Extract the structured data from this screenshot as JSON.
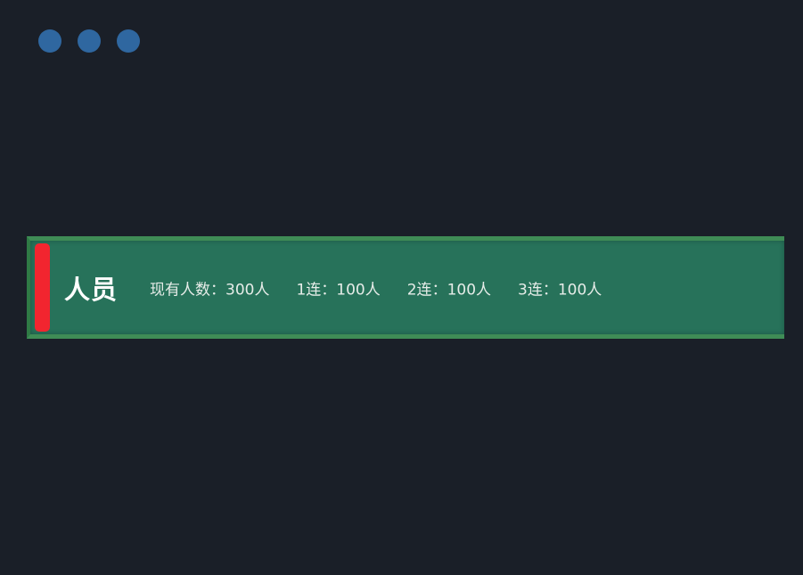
{
  "window_controls": {
    "dot_color": "#2f67a0",
    "dots": [
      "window-dot",
      "window-dot",
      "window-dot"
    ]
  },
  "banner": {
    "title": "人员",
    "accent_color": "#f2252f",
    "background_color": "#27725a",
    "stats": [
      {
        "label": "现有人数",
        "separator": "：",
        "value": "300人"
      },
      {
        "label": "1连",
        "separator": "：",
        "value": "100人"
      },
      {
        "label": "2连",
        "separator": "：",
        "value": "100人"
      },
      {
        "label": "3连",
        "separator": "：",
        "value": "100人"
      }
    ]
  }
}
